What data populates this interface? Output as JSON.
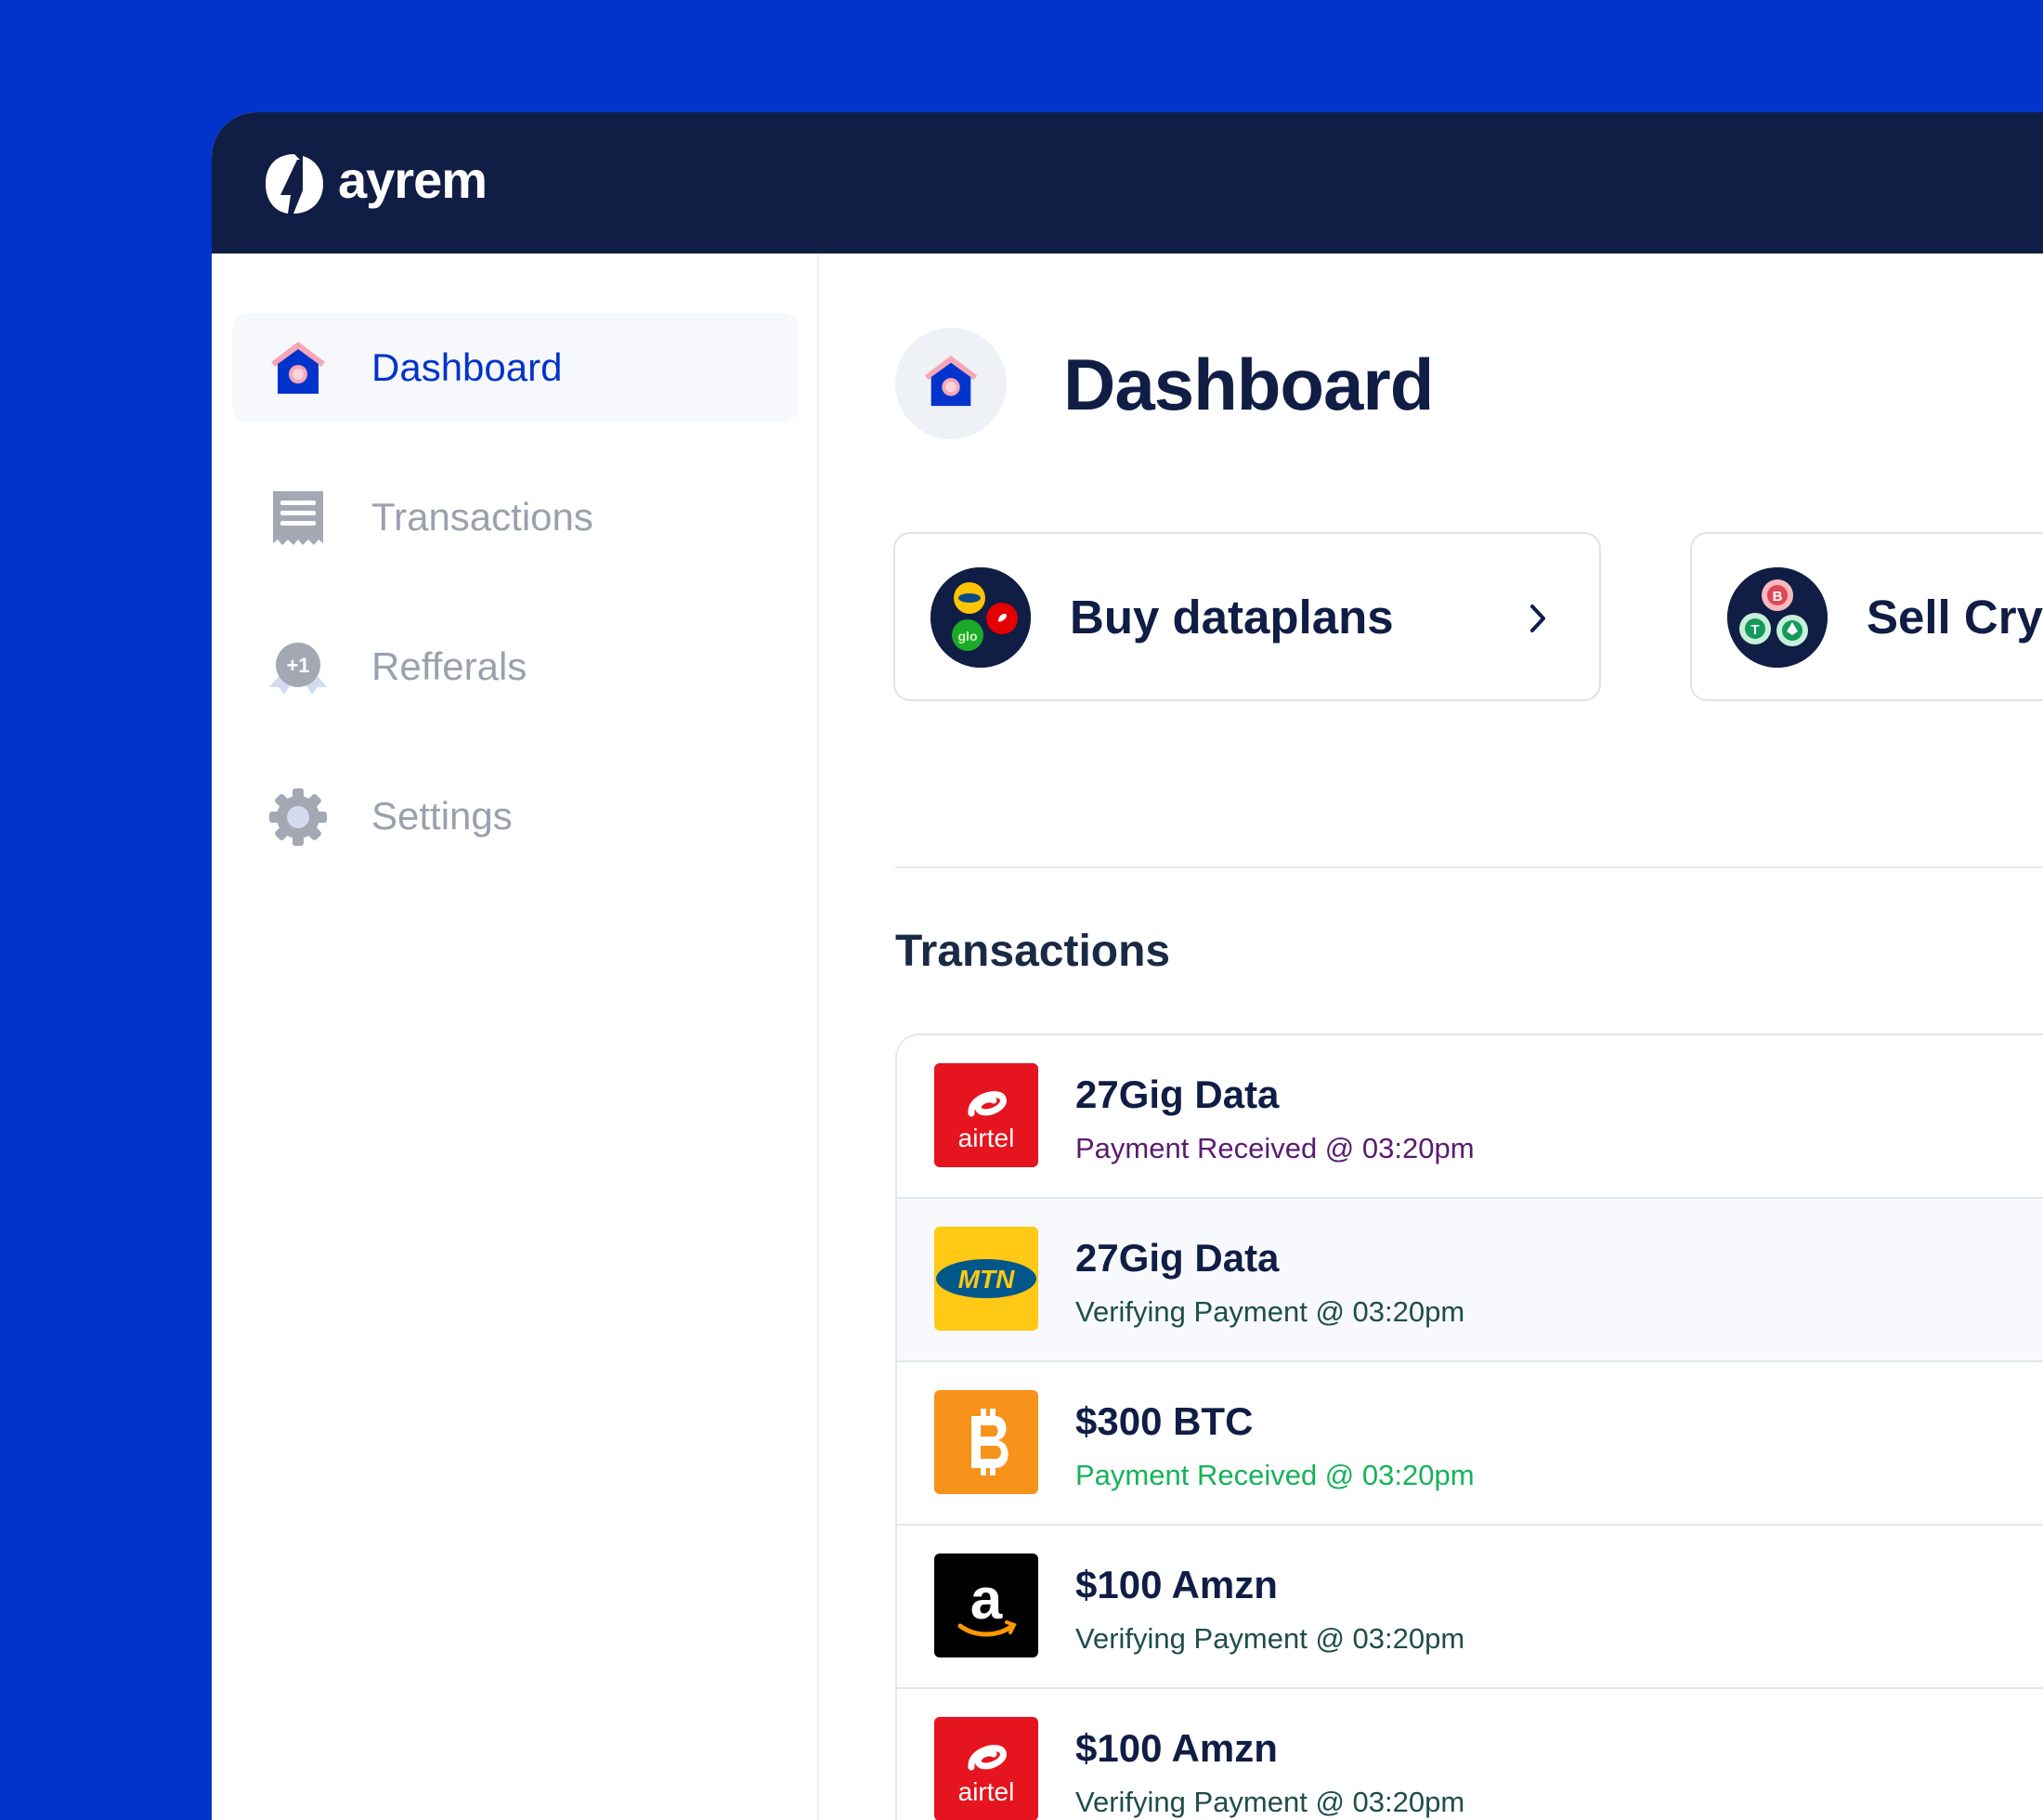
{
  "app": {
    "name": "ayrem"
  },
  "sidebar": {
    "items": [
      {
        "label": "Dashboard",
        "icon": "home-icon",
        "active": true
      },
      {
        "label": "Transactions",
        "icon": "receipt-icon",
        "active": false
      },
      {
        "label": "Refferals",
        "icon": "referral-badge-icon",
        "active": false
      },
      {
        "label": "Settings",
        "icon": "gear-icon",
        "active": false
      }
    ]
  },
  "main": {
    "title": "Dashboard",
    "actions": [
      {
        "label": "Buy dataplans",
        "icon": "network-providers-icon"
      },
      {
        "label": "Sell Cry",
        "icon": "crypto-coins-icon"
      }
    ],
    "transactions_title": "Transactions",
    "transactions": [
      {
        "name": "27Gig Data",
        "status": "Payment Received @ 03:20pm",
        "status_color": "#5B1B6E",
        "logo": "airtel-logo"
      },
      {
        "name": "27Gig Data",
        "status": "Verifying Payment @ 03:20pm",
        "status_color": "#1E4D4A",
        "logo": "mtn-logo"
      },
      {
        "name": "$300 BTC",
        "status": "Payment Received @ 03:20pm",
        "status_color": "#16B25A",
        "logo": "bitcoin-logo"
      },
      {
        "name": "$100 Amzn",
        "status": "Verifying Payment @ 03:20pm",
        "status_color": "#1E4D4A",
        "logo": "amazon-logo"
      },
      {
        "name": "$100 Amzn",
        "status": "Verifying Payment @ 03:20pm",
        "status_color": "#1E4D4A",
        "logo": "airtel-logo"
      }
    ],
    "logo_texts": {
      "airtel": "airtel",
      "mtn": "MTN"
    }
  },
  "colors": {
    "background": "#0234CC",
    "topbar": "#101D45",
    "accent": "#0234CC",
    "title": "#101D45"
  }
}
